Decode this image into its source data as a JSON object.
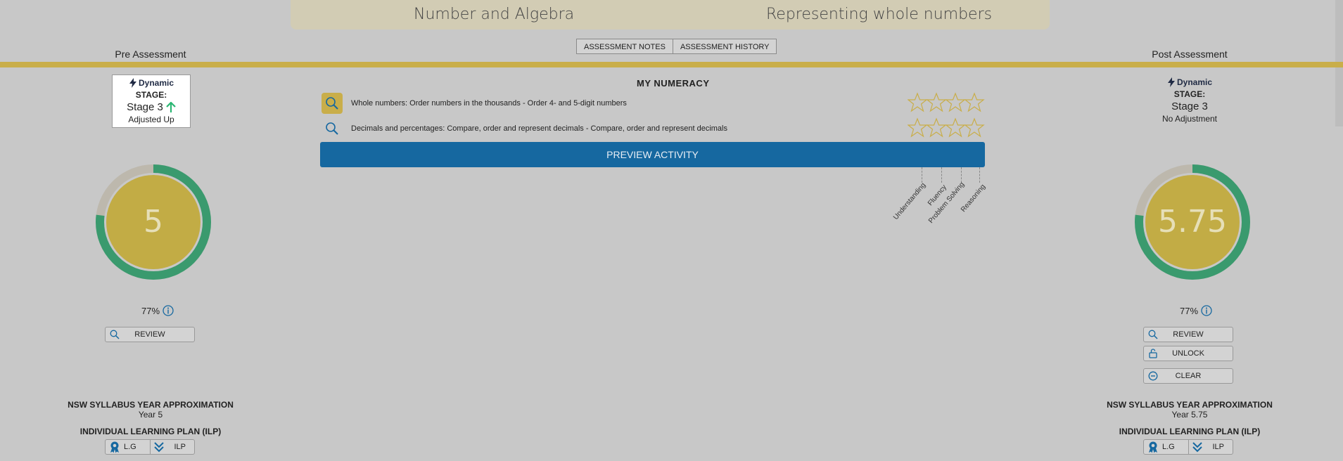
{
  "header": {
    "strand": "Number and Algebra",
    "topic": "Representing whole numbers"
  },
  "tabs": [
    {
      "label": "ASSESSMENT NOTES"
    },
    {
      "label": "ASSESSMENT HISTORY"
    }
  ],
  "pre": {
    "title": "Pre Assessment",
    "dynamic_label": "Dynamic",
    "stage_label": "STAGE:",
    "stage_value": "Stage 3",
    "adjustment": "Adjusted Up",
    "score": "5",
    "score_progress": 0.77,
    "percent": "77%",
    "review_label": "REVIEW",
    "syllabus_heading": "NSW SYLLABUS YEAR APPROXIMATION",
    "syllabus_value": "Year 5",
    "ilp_heading": "INDIVIDUAL LEARNING PLAN (ILP)",
    "lg_label": "L.G",
    "ilp_label": "ILP"
  },
  "post": {
    "title": "Post Assessment",
    "dynamic_label": "Dynamic",
    "stage_label": "STAGE:",
    "stage_value": "Stage 3",
    "adjustment": "No Adjustment",
    "score": "5.75",
    "score_progress": 0.77,
    "percent": "77%",
    "review_label": "REVIEW",
    "unlock_label": "UNLOCK",
    "clear_label": "CLEAR",
    "syllabus_heading": "NSW SYLLABUS YEAR APPROXIMATION",
    "syllabus_value": "Year 5.75",
    "ilp_heading": "INDIVIDUAL LEARNING PLAN (ILP)",
    "lg_label": "L.G",
    "ilp_label": "ILP"
  },
  "numeracy": {
    "title": "MY NUMERACY",
    "items": [
      {
        "text": "Whole numbers: Order numbers in the thousands - Order 4- and 5-digit numbers",
        "active": true,
        "stars_filled": 0
      },
      {
        "text": "Decimals and percentages: Compare, order and represent decimals - Compare, order and represent decimals",
        "active": false,
        "stars_filled": 0
      }
    ],
    "preview_label": "PREVIEW ACTIVITY",
    "proficiencies": [
      "Understanding",
      "Fluency",
      "Problem Solving",
      "Reasoning"
    ]
  },
  "colors": {
    "gold": "#c9ae4a",
    "ring_green": "#3a9a6e",
    "ring_empty": "#bdb8ad",
    "preview_blue": "#1668a0",
    "arrow_green": "#2bb673"
  }
}
